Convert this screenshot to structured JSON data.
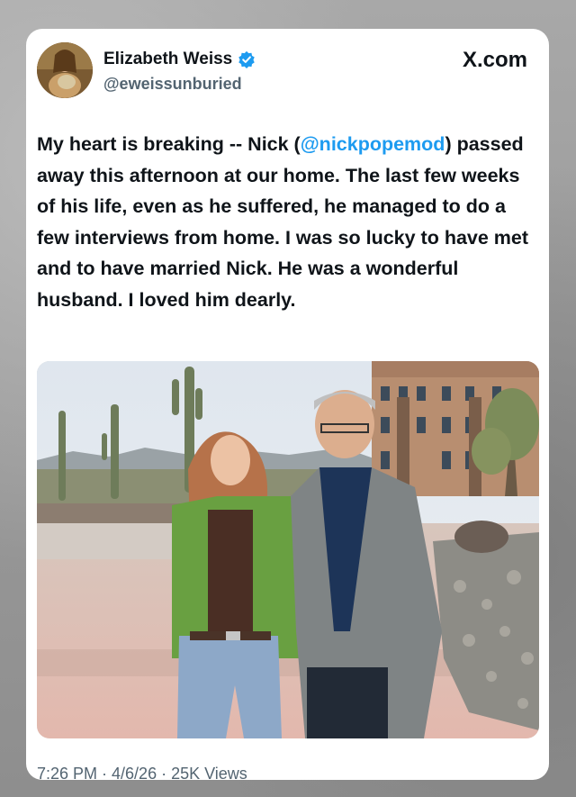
{
  "source": "X.com",
  "author": {
    "name": "Elizabeth Weiss",
    "handle": "@eweissunburied",
    "verified": true
  },
  "tweet": {
    "text_before_mention": "My heart is breaking -- Nick (",
    "mention": "@nickpopemod",
    "text_after_mention": ") passed away this afternoon at our home. The last few weeks of his life, even as he suffered, he managed to do a few interviews from home. I was so lucky to have met and to have married Nick. He was a wonderful husband. I loved him dearly."
  },
  "footer": "7:26 PM · 4/6/26 · 25K Views",
  "colors": {
    "link": "#1d9bf0",
    "verified_badge": "#1d9bf0",
    "text": "#0f1419",
    "muted": "#536471"
  }
}
